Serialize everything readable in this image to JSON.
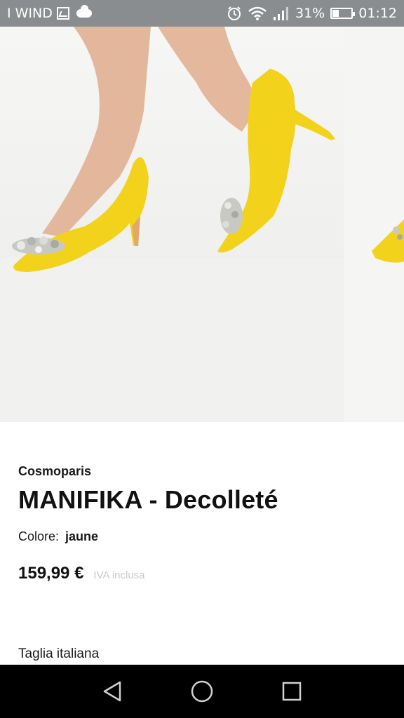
{
  "status_bar": {
    "carrier": "I WIND",
    "battery_percent": "31%",
    "battery_level": 0.31,
    "time": "01:12",
    "icons": [
      "image-icon",
      "cloud-icon",
      "alarm-icon",
      "wifi-icon",
      "signal-icon",
      "battery-icon"
    ]
  },
  "product": {
    "brand": "Cosmoparis",
    "name": "MANIFIKA - Decolleté",
    "color_label": "Colore:",
    "color_value": "jaune",
    "price": "159,99 €",
    "vat_note": "IVA inclusa",
    "size_label": "Taglia italiana"
  },
  "gallery": {
    "image_subject": "yellow-satin-pumps-with-jewel-bow",
    "shoe_color": "#f2d21b",
    "background_color": "#f4f4f3"
  },
  "nav_bar": {
    "buttons": [
      "back-icon",
      "home-icon",
      "recents-icon"
    ]
  }
}
